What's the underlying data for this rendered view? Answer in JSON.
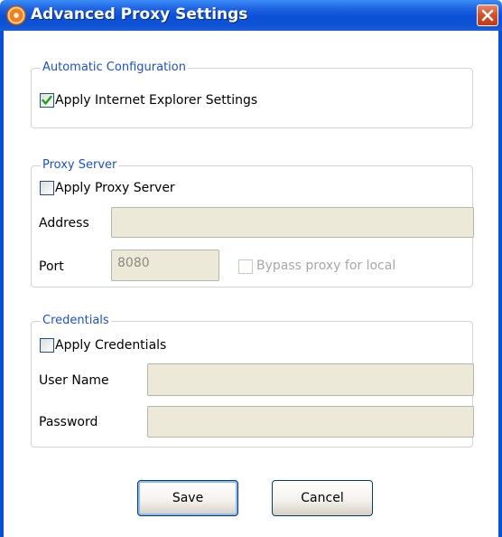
{
  "window": {
    "title": "Advanced Proxy Settings",
    "app_icon": "orange-ring-icon",
    "close_icon": "close-icon"
  },
  "automatic_configuration": {
    "legend": "Automatic Configuration",
    "apply_ie_settings": {
      "label": "Apply Internet Explorer Settings",
      "checked": true
    }
  },
  "proxy_server": {
    "legend": "Proxy Server",
    "apply_proxy_server": {
      "label": "Apply Proxy Server",
      "checked": false
    },
    "address": {
      "label": "Address",
      "value": ""
    },
    "port": {
      "label": "Port",
      "value": "8080"
    },
    "bypass_local": {
      "label": "Bypass proxy for local",
      "checked": false,
      "enabled": false
    }
  },
  "credentials": {
    "legend": "Credentials",
    "apply_credentials": {
      "label": "Apply Credentials",
      "checked": false
    },
    "user_name": {
      "label": "User Name",
      "value": ""
    },
    "password": {
      "label": "Password",
      "value": ""
    }
  },
  "buttons": {
    "save": "Save",
    "cancel": "Cancel"
  },
  "colors": {
    "titlebar": "#0a4fd8",
    "legend_text": "#1c50c8",
    "disabled_field": "#ece9d8",
    "check_mark": "#21a121"
  }
}
